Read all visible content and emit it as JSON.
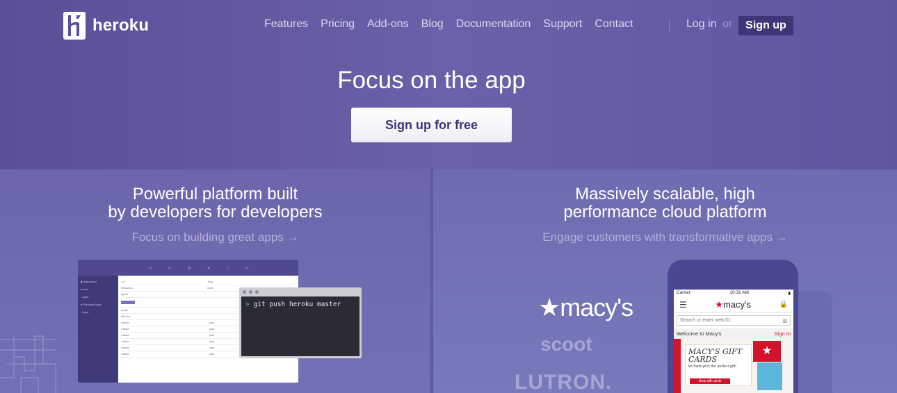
{
  "brand": {
    "name": "heroku"
  },
  "nav": {
    "items": [
      "Features",
      "Pricing",
      "Add-ons",
      "Blog",
      "Documentation",
      "Support",
      "Contact"
    ],
    "login": "Log in",
    "or": "or",
    "signup": "Sign up"
  },
  "hero": {
    "title": "Focus on the app",
    "cta": "Sign up for free"
  },
  "left_panel": {
    "title_line1": "Powerful platform built",
    "title_line2": "by developers for developers",
    "subtitle": "Focus on building great apps →",
    "terminal_prompt": ">",
    "terminal_command": "git push heroku master"
  },
  "right_panel": {
    "title_line1": "Massively scalable, high",
    "title_line2": "performance cloud platform",
    "subtitle": "Engage customers with transformative apps →",
    "logos": [
      "★macy's",
      "scoot",
      "LUTRON."
    ],
    "phone": {
      "carrier": "Carrier",
      "time": "10:31 AM",
      "app_logo": "macy's",
      "search_placeholder": "Search or enter web ID",
      "welcome": "Welcome to Macy's",
      "sign_in": "Sign In",
      "gift_title": "MACY'S GIFT CARDS",
      "gift_sub": "let them pick the perfect gift!",
      "gift_shop": "shop gift cards"
    }
  },
  "colors": {
    "background": "#6660a6",
    "signup_bg": "#3d3577",
    "cta_text": "#3d3577"
  }
}
